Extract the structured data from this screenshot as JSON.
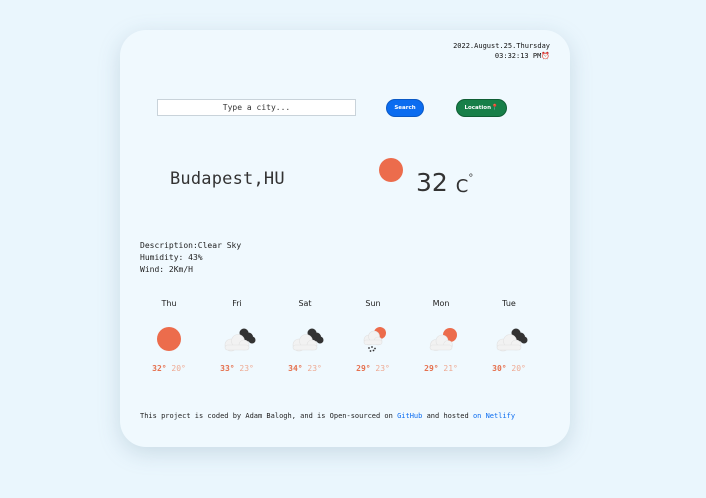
{
  "datetime": {
    "date": "2022.August.25.Thursday",
    "time": "03:32:13 PM"
  },
  "search": {
    "placeholder": "Type a city...",
    "value": "",
    "button_label": "Search"
  },
  "location_button": {
    "label": "Location"
  },
  "current": {
    "city": "Budapest,HU",
    "temp": "32",
    "unit": "C",
    "degree": "°",
    "icon": "sun-icon",
    "description_label": "Description:",
    "description": "Clear Sky",
    "humidity_label": "Humidity: ",
    "humidity": "43%",
    "wind_label": "Wind: ",
    "wind": "2Km/H"
  },
  "forecast": [
    {
      "day": "Thu",
      "icon": "sun-icon",
      "max": "32°",
      "min": "20°"
    },
    {
      "day": "Fri",
      "icon": "cloudy-icon",
      "max": "33°",
      "min": "23°"
    },
    {
      "day": "Sat",
      "icon": "cloudy-icon",
      "max": "34°",
      "min": "23°"
    },
    {
      "day": "Sun",
      "icon": "rain-sun-icon",
      "max": "29°",
      "min": "23°"
    },
    {
      "day": "Mon",
      "icon": "partly-cloudy-icon",
      "max": "29°",
      "min": "21°"
    },
    {
      "day": "Tue",
      "icon": "cloudy-icon",
      "max": "30°",
      "min": "20°"
    }
  ],
  "footer": {
    "text1": "This project is coded by Adam Balogh, and is Open-sourced on ",
    "link1": "GitHub",
    "text2": " and hosted ",
    "link2": "on Netlify"
  },
  "colors": {
    "sun": "#ec6c4c",
    "search_button": "#0b6cf0",
    "location_button": "#177f48",
    "temp_max": "#e5714f",
    "temp_min": "#eeaa93",
    "link": "#0b6cf0"
  }
}
